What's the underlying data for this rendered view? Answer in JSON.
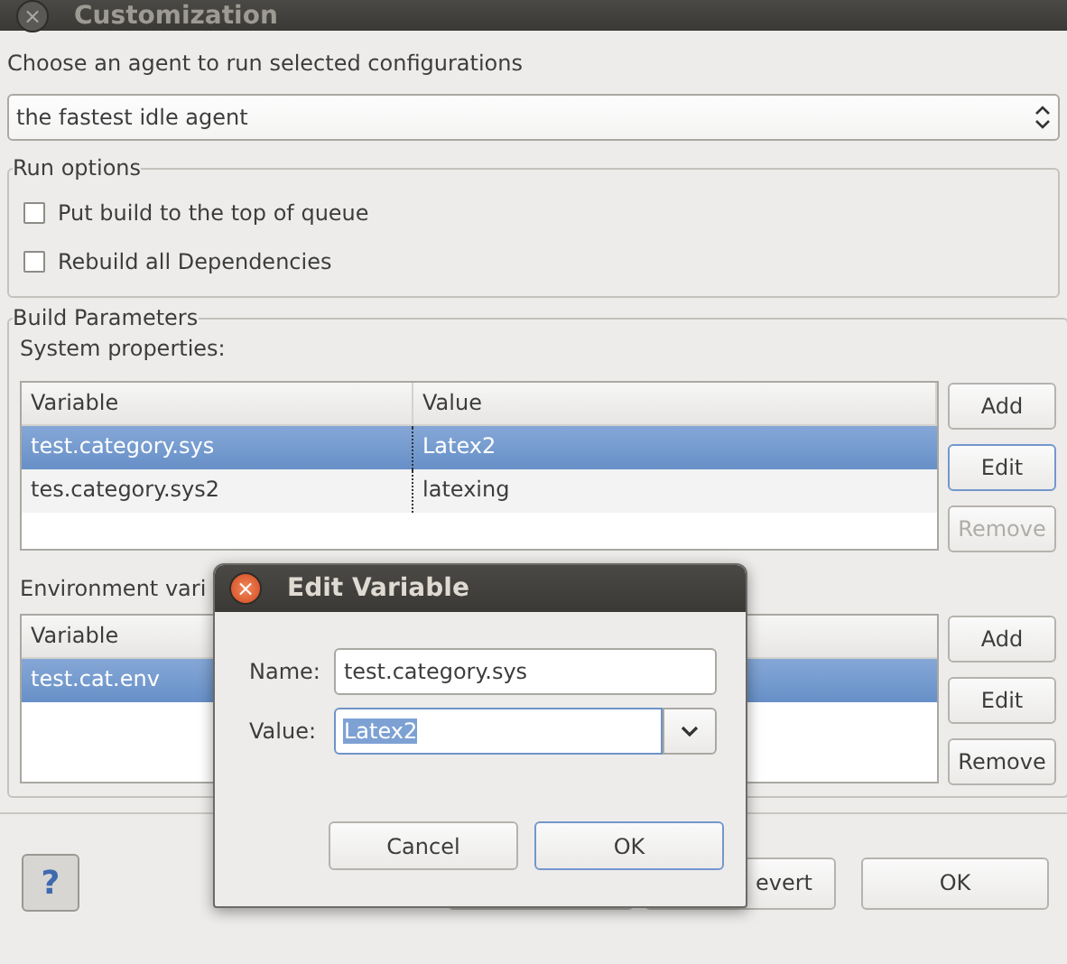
{
  "window": {
    "title": "Customization",
    "close": "×"
  },
  "agent": {
    "label": "Choose an agent to run selected configurations",
    "value": "the fastest idle agent"
  },
  "run_options": {
    "legend": "Run options",
    "options": [
      {
        "label": "Put build to the top of queue",
        "checked": false
      },
      {
        "label": "Rebuild all Dependencies",
        "checked": false
      }
    ]
  },
  "build_parameters": {
    "legend": "Build Parameters",
    "system": {
      "label": "System properties:",
      "columns": [
        "Variable",
        "Value"
      ],
      "rows": [
        {
          "cells": [
            "test.category.sys",
            "Latex2"
          ],
          "selected": true
        },
        {
          "cells": [
            "tes.category.sys2",
            "latexing"
          ],
          "selected": false
        }
      ],
      "buttons": [
        {
          "label": "Add",
          "disabled": false,
          "focused": false
        },
        {
          "label": "Edit",
          "disabled": false,
          "focused": true
        },
        {
          "label": "Remove",
          "disabled": true,
          "focused": false
        }
      ]
    },
    "environment": {
      "label": "Environment vari",
      "columns": [
        "Variable"
      ],
      "rows": [
        {
          "cells": [
            "test.cat.env"
          ],
          "selected": true
        }
      ],
      "buttons": [
        {
          "label": "Add",
          "disabled": false,
          "focused": false
        },
        {
          "label": "Edit",
          "disabled": false,
          "focused": false
        },
        {
          "label": "Remove",
          "disabled": false,
          "focused": false
        }
      ]
    }
  },
  "footer": {
    "help": "?",
    "buttons": [
      {
        "label": "evert"
      },
      {
        "label": "OK"
      }
    ]
  },
  "dialog": {
    "title": "Edit Variable",
    "name_label": "Name:",
    "name_value": "test.category.sys",
    "value_label": "Value:",
    "value_value": "Latex2",
    "value_text_selected": true,
    "buttons": [
      {
        "label": "Cancel",
        "focused": false
      },
      {
        "label": "OK",
        "focused": true
      }
    ]
  }
}
